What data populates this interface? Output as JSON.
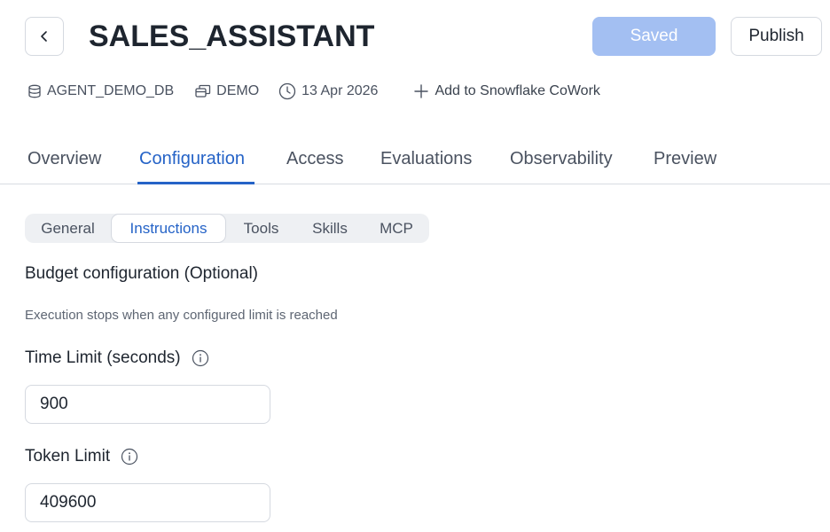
{
  "header": {
    "title": "SALES_ASSISTANT",
    "saved_label": "Saved",
    "publish_label": "Publish"
  },
  "meta": {
    "database": "AGENT_DEMO_DB",
    "schema": "DEMO",
    "date": "13 Apr 2026",
    "add_link": "Add to Snowflake CoWork"
  },
  "tabs": [
    {
      "label": "Overview"
    },
    {
      "label": "Configuration"
    },
    {
      "label": "Access"
    },
    {
      "label": "Evaluations"
    },
    {
      "label": "Observability"
    },
    {
      "label": "Preview"
    }
  ],
  "subtabs": [
    {
      "label": "General"
    },
    {
      "label": "Instructions"
    },
    {
      "label": "Tools"
    },
    {
      "label": "Skills"
    },
    {
      "label": "MCP"
    }
  ],
  "budget": {
    "title": "Budget configuration (Optional)",
    "description": "Execution stops when any configured limit is reached",
    "time_limit_label": "Time Limit (seconds)",
    "time_limit_value": "900",
    "token_limit_label": "Token Limit",
    "token_limit_value": "409600"
  },
  "colors": {
    "accent": "#2563c7",
    "saved_bg": "#a3bff2",
    "text": "#1e252f",
    "muted": "#4a5260",
    "border": "#d5d9e0"
  }
}
